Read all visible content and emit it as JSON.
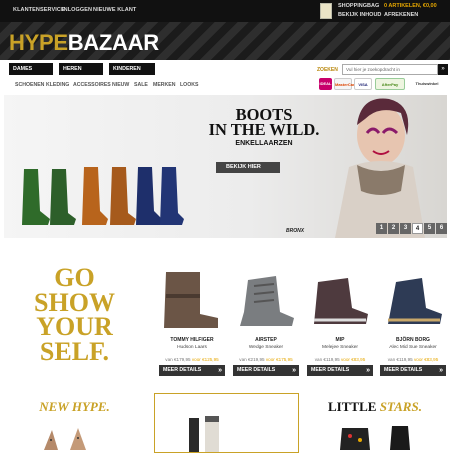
{
  "topbar": {
    "links": [
      "KLANTENSERVICE",
      "INLOGGEN",
      "NIEUWE KLANT"
    ],
    "cart_title": "SHOPPINGBAG",
    "cart_items": "0 ARTIKELEN, €0,00",
    "cart_view": "BEKIJK INHOUD",
    "cart_checkout": "AFREKENEN"
  },
  "logo": {
    "part1": "HYPE",
    "part2": "BAZAAR"
  },
  "categories": [
    "DAMES",
    "HEREN",
    "KINDEREN"
  ],
  "search": {
    "label": "ZOEKEN",
    "placeholder": "Vul hier je zoekopdracht in",
    "button": "»"
  },
  "nav": [
    "SCHOENEN",
    "KLEDING",
    "ACCESSOIRES",
    "NIEUW",
    "SALE",
    "MERKEN",
    "LOOKS"
  ],
  "payments": [
    "iDEAL",
    "MasterCard",
    "VISA",
    "AfterPay",
    "Thuiswinkel"
  ],
  "hero": {
    "title_line1": "BOOTS",
    "title_line2": "IN THE WILD.",
    "subtitle": "ENKELLAARZEN",
    "cta": "BEKIJK HIER",
    "caption": "BRONX",
    "pages": [
      "1",
      "2",
      "3",
      "4",
      "5",
      "6"
    ],
    "active_page": "4"
  },
  "promo": {
    "line1": "GO",
    "line2": "SHOW",
    "line3": "YOUR",
    "line4": "SELF."
  },
  "products": [
    {
      "brand": "TOMMY HILFIGER",
      "name": "Hudson Laars",
      "old": "van €179,95",
      "new": "voor €125,95",
      "button": "MEER DETAILS"
    },
    {
      "brand": "AIRSTEP",
      "name": "Wedge Sneaker",
      "old": "van €219,95",
      "new": "voor €175,95",
      "button": "MEER DETAILS"
    },
    {
      "brand": "MIP",
      "name": "Melejee Sneaker",
      "old": "van €119,95",
      "new": "voor €83,95",
      "button": "MEER DETAILS"
    },
    {
      "brand": "BJÖRN BORG",
      "name": "Alec Mid Sue Sneaker",
      "old": "van €119,95",
      "new": "voor €83,95",
      "button": "MEER DETAILS"
    }
  ],
  "sections": {
    "new_hype": "NEW HYPE.",
    "little": "LITTLE",
    "stars": "STARS."
  },
  "colors": {
    "gold": "#c9a227",
    "orange": "#e6a700",
    "dark": "#111111"
  },
  "icons": [
    "shopping-bag-icon",
    "search-icon",
    "arrow-right-icon"
  ]
}
